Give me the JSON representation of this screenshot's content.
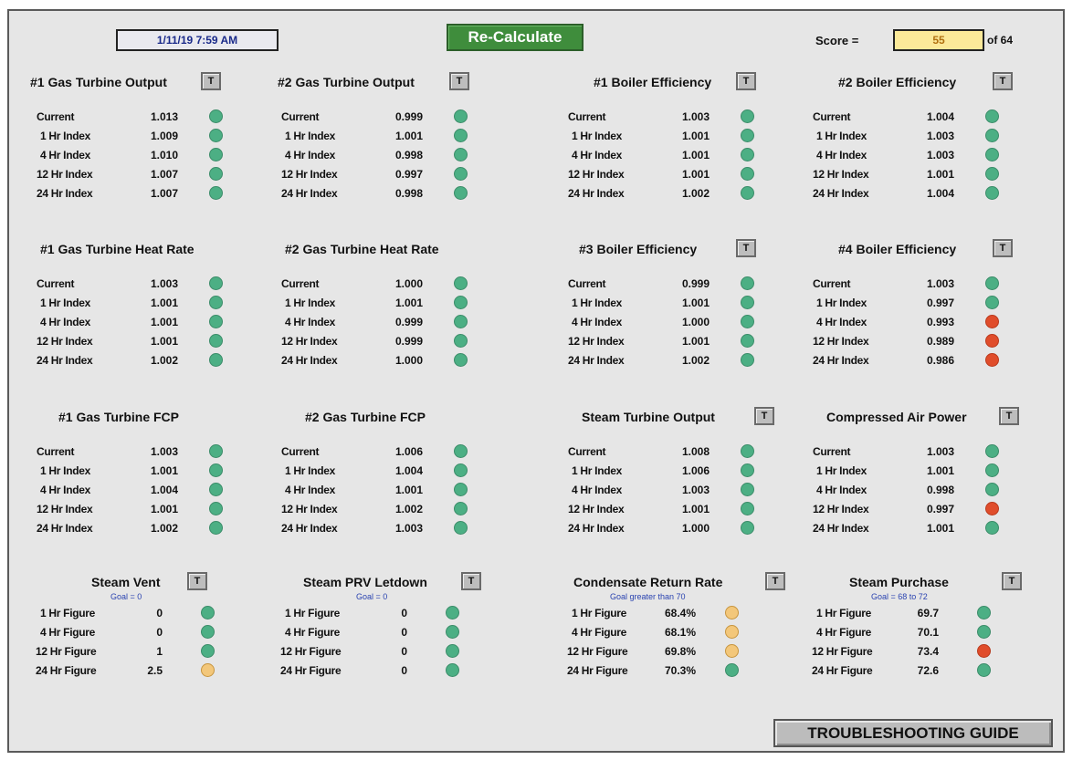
{
  "header": {
    "datetime": "1/11/19 7:59 AM",
    "recalculate_label": "Re-Calculate",
    "score_label": "Score =",
    "score_value": "55",
    "score_of": "of  64"
  },
  "panels": [
    {
      "title": "#1 Gas Turbine Output",
      "t_label": "T",
      "goal": "",
      "rows": [
        {
          "label": "Current",
          "value": "1.013",
          "status": "green"
        },
        {
          "label": "1 Hr Index",
          "value": "1.009",
          "status": "green"
        },
        {
          "label": "4 Hr Index",
          "value": "1.010",
          "status": "green"
        },
        {
          "label": "12 Hr Index",
          "value": "1.007",
          "status": "green"
        },
        {
          "label": "24 Hr Index",
          "value": "1.007",
          "status": "green"
        }
      ]
    },
    {
      "title": "#2 Gas Turbine Output",
      "t_label": "T",
      "goal": "",
      "rows": [
        {
          "label": "Current",
          "value": "0.999",
          "status": "green"
        },
        {
          "label": "1 Hr Index",
          "value": "1.001",
          "status": "green"
        },
        {
          "label": "4 Hr Index",
          "value": "0.998",
          "status": "green"
        },
        {
          "label": "12 Hr Index",
          "value": "0.997",
          "status": "green"
        },
        {
          "label": "24 Hr Index",
          "value": "0.998",
          "status": "green"
        }
      ]
    },
    {
      "title": "#1 Boiler Efficiency",
      "t_label": "T",
      "goal": "",
      "rows": [
        {
          "label": "Current",
          "value": "1.003",
          "status": "green"
        },
        {
          "label": "1 Hr Index",
          "value": "1.001",
          "status": "green"
        },
        {
          "label": "4 Hr Index",
          "value": "1.001",
          "status": "green"
        },
        {
          "label": "12 Hr Index",
          "value": "1.001",
          "status": "green"
        },
        {
          "label": "24 Hr Index",
          "value": "1.002",
          "status": "green"
        }
      ]
    },
    {
      "title": "#2 Boiler Efficiency",
      "t_label": "T",
      "goal": "",
      "rows": [
        {
          "label": "Current",
          "value": "1.004",
          "status": "green"
        },
        {
          "label": "1 Hr Index",
          "value": "1.003",
          "status": "green"
        },
        {
          "label": "4 Hr Index",
          "value": "1.003",
          "status": "green"
        },
        {
          "label": "12 Hr Index",
          "value": "1.001",
          "status": "green"
        },
        {
          "label": "24 Hr Index",
          "value": "1.004",
          "status": "green"
        }
      ]
    },
    {
      "title": "#1 Gas Turbine Heat Rate",
      "t_label": "",
      "goal": "",
      "rows": [
        {
          "label": "Current",
          "value": "1.003",
          "status": "green"
        },
        {
          "label": "1 Hr Index",
          "value": "1.001",
          "status": "green"
        },
        {
          "label": "4 Hr Index",
          "value": "1.001",
          "status": "green"
        },
        {
          "label": "12 Hr Index",
          "value": "1.001",
          "status": "green"
        },
        {
          "label": "24 Hr Index",
          "value": "1.002",
          "status": "green"
        }
      ]
    },
    {
      "title": "#2 Gas Turbine Heat Rate",
      "t_label": "",
      "goal": "",
      "rows": [
        {
          "label": "Current",
          "value": "1.000",
          "status": "green"
        },
        {
          "label": "1 Hr Index",
          "value": "1.001",
          "status": "green"
        },
        {
          "label": "4 Hr Index",
          "value": "0.999",
          "status": "green"
        },
        {
          "label": "12 Hr Index",
          "value": "0.999",
          "status": "green"
        },
        {
          "label": "24 Hr Index",
          "value": "1.000",
          "status": "green"
        }
      ]
    },
    {
      "title": "#3 Boiler Efficiency",
      "t_label": "T",
      "goal": "",
      "rows": [
        {
          "label": "Current",
          "value": "0.999",
          "status": "green"
        },
        {
          "label": "1 Hr Index",
          "value": "1.001",
          "status": "green"
        },
        {
          "label": "4 Hr Index",
          "value": "1.000",
          "status": "green"
        },
        {
          "label": "12 Hr Index",
          "value": "1.001",
          "status": "green"
        },
        {
          "label": "24 Hr Index",
          "value": "1.002",
          "status": "green"
        }
      ]
    },
    {
      "title": "#4 Boiler Efficiency",
      "t_label": "T",
      "goal": "",
      "rows": [
        {
          "label": "Current",
          "value": "1.003",
          "status": "green"
        },
        {
          "label": "1 Hr Index",
          "value": "0.997",
          "status": "green"
        },
        {
          "label": "4 Hr Index",
          "value": "0.993",
          "status": "red"
        },
        {
          "label": "12 Hr Index",
          "value": "0.989",
          "status": "red"
        },
        {
          "label": "24 Hr Index",
          "value": "0.986",
          "status": "red"
        }
      ]
    },
    {
      "title": "#1 Gas Turbine FCP",
      "t_label": "",
      "goal": "",
      "rows": [
        {
          "label": "Current",
          "value": "1.003",
          "status": "green"
        },
        {
          "label": "1 Hr Index",
          "value": "1.001",
          "status": "green"
        },
        {
          "label": "4 Hr Index",
          "value": "1.004",
          "status": "green"
        },
        {
          "label": "12 Hr Index",
          "value": "1.001",
          "status": "green"
        },
        {
          "label": "24 Hr Index",
          "value": "1.002",
          "status": "green"
        }
      ]
    },
    {
      "title": "#2 Gas Turbine FCP",
      "t_label": "",
      "goal": "",
      "rows": [
        {
          "label": "Current",
          "value": "1.006",
          "status": "green"
        },
        {
          "label": "1 Hr Index",
          "value": "1.004",
          "status": "green"
        },
        {
          "label": "4 Hr Index",
          "value": "1.001",
          "status": "green"
        },
        {
          "label": "12 Hr Index",
          "value": "1.002",
          "status": "green"
        },
        {
          "label": "24 Hr Index",
          "value": "1.003",
          "status": "green"
        }
      ]
    },
    {
      "title": "Steam Turbine Output",
      "t_label": "T",
      "goal": "",
      "rows": [
        {
          "label": "Current",
          "value": "1.008",
          "status": "green"
        },
        {
          "label": "1 Hr Index",
          "value": "1.006",
          "status": "green"
        },
        {
          "label": "4 Hr Index",
          "value": "1.003",
          "status": "green"
        },
        {
          "label": "12 Hr Index",
          "value": "1.001",
          "status": "green"
        },
        {
          "label": "24 Hr Index",
          "value": "1.000",
          "status": "green"
        }
      ]
    },
    {
      "title": "Compressed Air Power",
      "t_label": "T",
      "goal": "",
      "rows": [
        {
          "label": "Current",
          "value": "1.003",
          "status": "green"
        },
        {
          "label": "1 Hr Index",
          "value": "1.001",
          "status": "green"
        },
        {
          "label": "4 Hr Index",
          "value": "0.998",
          "status": "green"
        },
        {
          "label": "12 Hr Index",
          "value": "0.997",
          "status": "red"
        },
        {
          "label": "24 Hr Index",
          "value": "1.001",
          "status": "green"
        }
      ]
    },
    {
      "title": "Steam Vent",
      "t_label": "T",
      "goal": "Goal = 0",
      "rows": [
        {
          "label": "1 Hr Figure",
          "value": "0",
          "status": "green"
        },
        {
          "label": "4 Hr Figure",
          "value": "0",
          "status": "green"
        },
        {
          "label": "12 Hr Figure",
          "value": "1",
          "status": "green"
        },
        {
          "label": "24 Hr Figure",
          "value": "2.5",
          "status": "yellow"
        }
      ]
    },
    {
      "title": "Steam PRV Letdown",
      "t_label": "T",
      "goal": "Goal = 0",
      "rows": [
        {
          "label": "1 Hr Figure",
          "value": "0",
          "status": "green"
        },
        {
          "label": "4 Hr Figure",
          "value": "0",
          "status": "green"
        },
        {
          "label": "12 Hr Figure",
          "value": "0",
          "status": "green"
        },
        {
          "label": "24 Hr Figure",
          "value": "0",
          "status": "green"
        }
      ]
    },
    {
      "title": "Condensate Return Rate",
      "t_label": "T",
      "goal": "Goal greater than 70",
      "rows": [
        {
          "label": "1 Hr Figure",
          "value": "68.4%",
          "status": "yellow"
        },
        {
          "label": "4 Hr Figure",
          "value": "68.1%",
          "status": "yellow"
        },
        {
          "label": "12 Hr Figure",
          "value": "69.8%",
          "status": "yellow"
        },
        {
          "label": "24 Hr Figure",
          "value": "70.3%",
          "status": "green"
        }
      ]
    },
    {
      "title": "Steam Purchase",
      "t_label": "T",
      "goal": "Goal = 68 to 72",
      "rows": [
        {
          "label": "1 Hr Figure",
          "value": "69.7",
          "status": "green"
        },
        {
          "label": "4 Hr Figure",
          "value": "70.1",
          "status": "green"
        },
        {
          "label": "12 Hr Figure",
          "value": "73.4",
          "status": "red"
        },
        {
          "label": "24 Hr Figure",
          "value": "72.6",
          "status": "green"
        }
      ]
    }
  ],
  "footer": {
    "troubleshooting_label": "TROUBLESHOOTING GUIDE"
  },
  "colors": {
    "green": "#4caf84",
    "red": "#e04d2b",
    "yellow": "#f3c77a",
    "recalc": "#3f8d3c",
    "score_bg": "#fbe999"
  }
}
